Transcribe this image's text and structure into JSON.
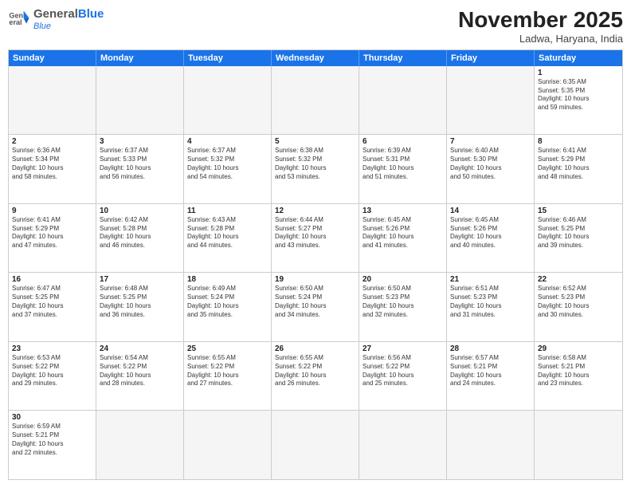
{
  "header": {
    "logo_general": "General",
    "logo_blue": "Blue",
    "month_title": "November 2025",
    "subtitle": "Ladwa, Haryana, India"
  },
  "days_of_week": [
    "Sunday",
    "Monday",
    "Tuesday",
    "Wednesday",
    "Thursday",
    "Friday",
    "Saturday"
  ],
  "weeks": [
    [
      {
        "day": "",
        "text": ""
      },
      {
        "day": "",
        "text": ""
      },
      {
        "day": "",
        "text": ""
      },
      {
        "day": "",
        "text": ""
      },
      {
        "day": "",
        "text": ""
      },
      {
        "day": "",
        "text": ""
      },
      {
        "day": "1",
        "text": "Sunrise: 6:35 AM\nSunset: 5:35 PM\nDaylight: 10 hours\nand 59 minutes."
      }
    ],
    [
      {
        "day": "2",
        "text": "Sunrise: 6:36 AM\nSunset: 5:34 PM\nDaylight: 10 hours\nand 58 minutes."
      },
      {
        "day": "3",
        "text": "Sunrise: 6:37 AM\nSunset: 5:33 PM\nDaylight: 10 hours\nand 56 minutes."
      },
      {
        "day": "4",
        "text": "Sunrise: 6:37 AM\nSunset: 5:32 PM\nDaylight: 10 hours\nand 54 minutes."
      },
      {
        "day": "5",
        "text": "Sunrise: 6:38 AM\nSunset: 5:32 PM\nDaylight: 10 hours\nand 53 minutes."
      },
      {
        "day": "6",
        "text": "Sunrise: 6:39 AM\nSunset: 5:31 PM\nDaylight: 10 hours\nand 51 minutes."
      },
      {
        "day": "7",
        "text": "Sunrise: 6:40 AM\nSunset: 5:30 PM\nDaylight: 10 hours\nand 50 minutes."
      },
      {
        "day": "8",
        "text": "Sunrise: 6:41 AM\nSunset: 5:29 PM\nDaylight: 10 hours\nand 48 minutes."
      }
    ],
    [
      {
        "day": "9",
        "text": "Sunrise: 6:41 AM\nSunset: 5:29 PM\nDaylight: 10 hours\nand 47 minutes."
      },
      {
        "day": "10",
        "text": "Sunrise: 6:42 AM\nSunset: 5:28 PM\nDaylight: 10 hours\nand 46 minutes."
      },
      {
        "day": "11",
        "text": "Sunrise: 6:43 AM\nSunset: 5:28 PM\nDaylight: 10 hours\nand 44 minutes."
      },
      {
        "day": "12",
        "text": "Sunrise: 6:44 AM\nSunset: 5:27 PM\nDaylight: 10 hours\nand 43 minutes."
      },
      {
        "day": "13",
        "text": "Sunrise: 6:45 AM\nSunset: 5:26 PM\nDaylight: 10 hours\nand 41 minutes."
      },
      {
        "day": "14",
        "text": "Sunrise: 6:45 AM\nSunset: 5:26 PM\nDaylight: 10 hours\nand 40 minutes."
      },
      {
        "day": "15",
        "text": "Sunrise: 6:46 AM\nSunset: 5:25 PM\nDaylight: 10 hours\nand 39 minutes."
      }
    ],
    [
      {
        "day": "16",
        "text": "Sunrise: 6:47 AM\nSunset: 5:25 PM\nDaylight: 10 hours\nand 37 minutes."
      },
      {
        "day": "17",
        "text": "Sunrise: 6:48 AM\nSunset: 5:25 PM\nDaylight: 10 hours\nand 36 minutes."
      },
      {
        "day": "18",
        "text": "Sunrise: 6:49 AM\nSunset: 5:24 PM\nDaylight: 10 hours\nand 35 minutes."
      },
      {
        "day": "19",
        "text": "Sunrise: 6:50 AM\nSunset: 5:24 PM\nDaylight: 10 hours\nand 34 minutes."
      },
      {
        "day": "20",
        "text": "Sunrise: 6:50 AM\nSunset: 5:23 PM\nDaylight: 10 hours\nand 32 minutes."
      },
      {
        "day": "21",
        "text": "Sunrise: 6:51 AM\nSunset: 5:23 PM\nDaylight: 10 hours\nand 31 minutes."
      },
      {
        "day": "22",
        "text": "Sunrise: 6:52 AM\nSunset: 5:23 PM\nDaylight: 10 hours\nand 30 minutes."
      }
    ],
    [
      {
        "day": "23",
        "text": "Sunrise: 6:53 AM\nSunset: 5:22 PM\nDaylight: 10 hours\nand 29 minutes."
      },
      {
        "day": "24",
        "text": "Sunrise: 6:54 AM\nSunset: 5:22 PM\nDaylight: 10 hours\nand 28 minutes."
      },
      {
        "day": "25",
        "text": "Sunrise: 6:55 AM\nSunset: 5:22 PM\nDaylight: 10 hours\nand 27 minutes."
      },
      {
        "day": "26",
        "text": "Sunrise: 6:55 AM\nSunset: 5:22 PM\nDaylight: 10 hours\nand 26 minutes."
      },
      {
        "day": "27",
        "text": "Sunrise: 6:56 AM\nSunset: 5:22 PM\nDaylight: 10 hours\nand 25 minutes."
      },
      {
        "day": "28",
        "text": "Sunrise: 6:57 AM\nSunset: 5:21 PM\nDaylight: 10 hours\nand 24 minutes."
      },
      {
        "day": "29",
        "text": "Sunrise: 6:58 AM\nSunset: 5:21 PM\nDaylight: 10 hours\nand 23 minutes."
      }
    ],
    [
      {
        "day": "30",
        "text": "Sunrise: 6:59 AM\nSunset: 5:21 PM\nDaylight: 10 hours\nand 22 minutes."
      },
      {
        "day": "",
        "text": ""
      },
      {
        "day": "",
        "text": ""
      },
      {
        "day": "",
        "text": ""
      },
      {
        "day": "",
        "text": ""
      },
      {
        "day": "",
        "text": ""
      },
      {
        "day": "",
        "text": ""
      }
    ]
  ]
}
